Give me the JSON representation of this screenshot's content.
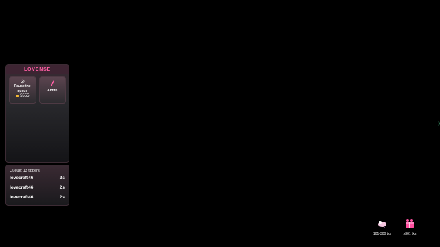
{
  "panel": {
    "brand": "LOVENSE",
    "actions": [
      {
        "icon": "pause-icon",
        "label_line1": "Pause the",
        "label_line2": "queue",
        "price": "5555"
      },
      {
        "icon": "anfi-toy-icon",
        "label_line1": "Anfife",
        "label_line2": "",
        "price": ""
      }
    ]
  },
  "queue": {
    "title": "Queue: 13 tippers",
    "rows": [
      {
        "name": "lovecraft46",
        "time": "2s"
      },
      {
        "name": "lovecraft46",
        "time": "2s"
      },
      {
        "name": "lovecraft46",
        "time": "2s"
      }
    ]
  },
  "levels": [
    {
      "icon": "toy-level-icon",
      "label": "101-300 tks"
    },
    {
      "icon": "gift-level-icon",
      "label": "≥301 tks"
    }
  ],
  "colors": {
    "brand": "#ff5fa4",
    "coin": "#f2b733"
  }
}
